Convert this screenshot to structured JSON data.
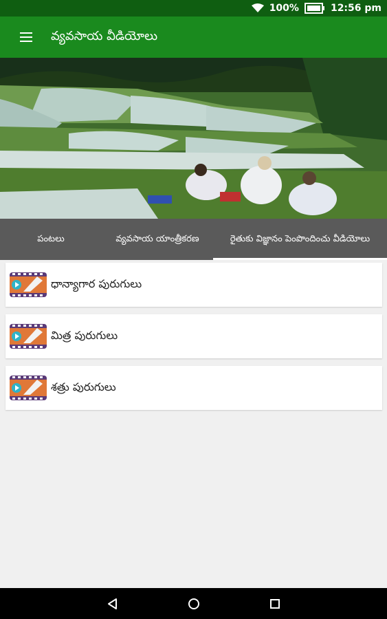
{
  "status_bar": {
    "battery": "100%",
    "time": "12:56 pm"
  },
  "app_bar": {
    "title": "వ్యవసాయ వీడియోలు",
    "menu_icon": "hamburger-menu-icon"
  },
  "hero": {
    "image": "rice-terrace-farmers-photo"
  },
  "tabs": [
    {
      "label": "పంటలు",
      "active": false
    },
    {
      "label": "వ్యవసాయ యాంత్రీకరణ",
      "active": false
    },
    {
      "label": "రైతుకు విజ్ఞానం పెంపొందించు వీడియోలు",
      "active": true
    }
  ],
  "items": [
    {
      "label": "ధాన్యాగార పురుగులు",
      "icon": "video-thumbnail-icon"
    },
    {
      "label": "మిత్ర పురుగులు",
      "icon": "video-thumbnail-icon"
    },
    {
      "label": "శత్రు పురుగులు",
      "icon": "video-thumbnail-icon"
    }
  ],
  "nav": {
    "back": "back-icon",
    "home": "home-icon",
    "recents": "recents-icon"
  },
  "colors": {
    "app_bar": "#1a8a1e",
    "status_bar": "#0f5e11",
    "tab_bar": "#5a5a5a"
  }
}
